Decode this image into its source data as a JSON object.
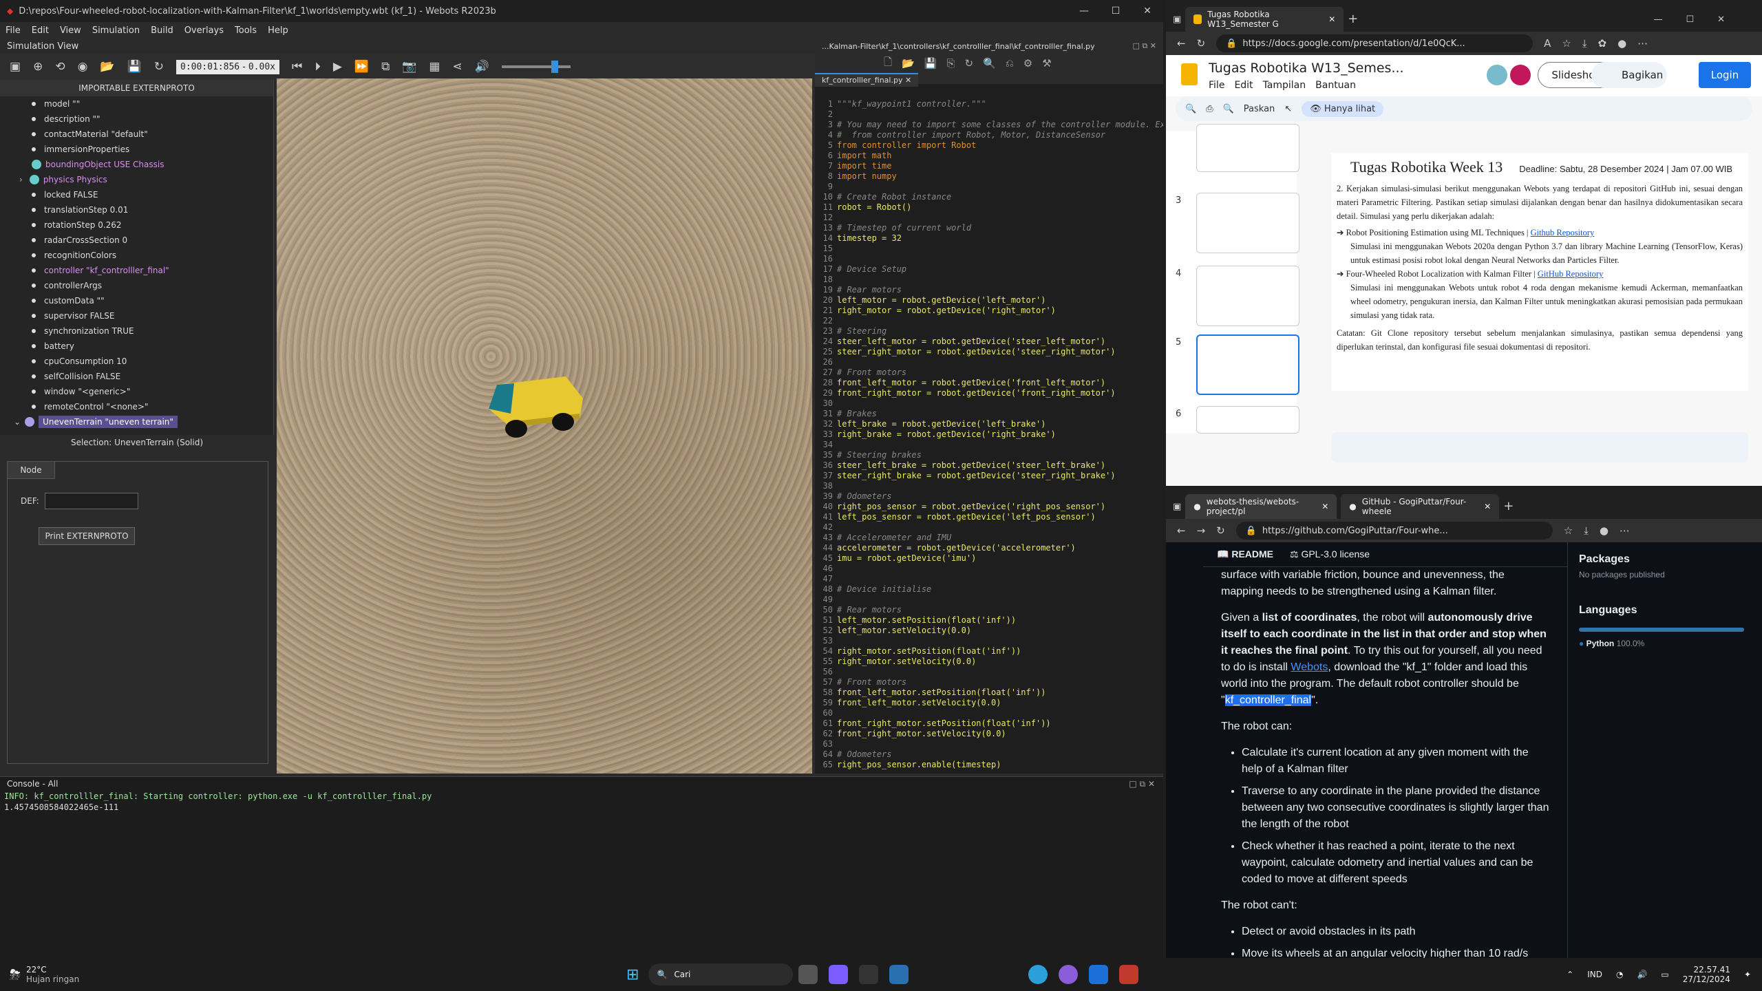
{
  "webots": {
    "title": "D:\\repos\\Four-wheeled-robot-localization-with-Kalman-Filter\\kf_1\\worlds\\empty.wbt (kf_1) - Webots R2023b",
    "menu": [
      "File",
      "Edit",
      "View",
      "Simulation",
      "Build",
      "Overlays",
      "Tools",
      "Help"
    ],
    "subtitle": "Simulation View",
    "time": "0:00:01:856",
    "speed": "0.00x",
    "tree_header": "IMPORTABLE EXTERNPROTO",
    "tree": [
      {
        "label": "model \"\"",
        "type": "dot"
      },
      {
        "label": "description \"\"",
        "type": "dot"
      },
      {
        "label": "contactMaterial \"default\"",
        "type": "dot"
      },
      {
        "label": "immersionProperties",
        "type": "dot"
      },
      {
        "label": "boundingObject USE Chassis",
        "type": "ball",
        "link": true
      },
      {
        "label": "physics Physics",
        "type": "ball",
        "link": true
      },
      {
        "label": "locked FALSE",
        "type": "dot"
      },
      {
        "label": "translationStep 0.01",
        "type": "dot"
      },
      {
        "label": "rotationStep 0.262",
        "type": "dot"
      },
      {
        "label": "radarCrossSection 0",
        "type": "dot"
      },
      {
        "label": "recognitionColors",
        "type": "dot"
      },
      {
        "label": "controller \"kf_controlller_final\"",
        "type": "dot",
        "link": true
      },
      {
        "label": "controllerArgs",
        "type": "dot"
      },
      {
        "label": "customData \"\"",
        "type": "dot"
      },
      {
        "label": "supervisor FALSE",
        "type": "dot"
      },
      {
        "label": "synchronization TRUE",
        "type": "dot"
      },
      {
        "label": "battery",
        "type": "dot"
      },
      {
        "label": "cpuConsumption 10",
        "type": "dot"
      },
      {
        "label": "selfCollision FALSE",
        "type": "dot"
      },
      {
        "label": "window \"<generic>\"",
        "type": "dot"
      },
      {
        "label": "remoteControl \"<none>\"",
        "type": "dot"
      }
    ],
    "selected_node": "UnevenTerrain \"uneven terrain\"",
    "selection": "Selection: UnevenTerrain (Solid)",
    "node_tab": "Node",
    "def_label": "DEF:",
    "print_button": "Print EXTERNPROTO",
    "editor_path": "...Kalman-Filter\\kf_1\\controllers\\kf_controlller_final\\kf_controlller_final.py",
    "editor_tab": "kf_controlller_final.py",
    "console_title": "Console - All",
    "console_lines": [
      "INFO: kf_controlller_final: Starting controller: python.exe -u kf_controlller_final.py",
      "1.4574508584022465e-111"
    ]
  },
  "code": [
    "\"\"\"kf_waypoint1 controller.\"\"\"",
    "",
    "# You may need to import some classes of the controller module. Ex",
    "#  from controller import Robot, Motor, DistanceSensor",
    "from controller import Robot",
    "import math",
    "import time",
    "import numpy",
    "",
    "# Create Robot instance",
    "robot = Robot()",
    "",
    "# Timestep of current world",
    "timestep = 32",
    "",
    "",
    "# Device Setup",
    "",
    "# Rear motors",
    "left_motor = robot.getDevice('left_motor')",
    "right_motor = robot.getDevice('right_motor')",
    "",
    "# Steering",
    "steer_left_motor = robot.getDevice('steer_left_motor')",
    "steer_right_motor = robot.getDevice('steer_right_motor')",
    "",
    "# Front motors",
    "front_left_motor = robot.getDevice('front_left_motor')",
    "front_right_motor = robot.getDevice('front_right_motor')",
    "",
    "# Brakes",
    "left_brake = robot.getDevice('left_brake')",
    "right_brake = robot.getDevice('right_brake')",
    "",
    "# Steering brakes",
    "steer_left_brake = robot.getDevice('steer_left_brake')",
    "steer_right_brake = robot.getDevice('steer_right_brake')",
    "",
    "# Odometers",
    "right_pos_sensor = robot.getDevice('right_pos_sensor')",
    "left_pos_sensor = robot.getDevice('left_pos_sensor')",
    "",
    "# Accelerometer and IMU",
    "accelerometer = robot.getDevice('accelerometer')",
    "imu = robot.getDevice('imu')",
    "",
    "",
    "# Device initialise",
    "",
    "# Rear motors",
    "left_motor.setPosition(float('inf'))",
    "left_motor.setVelocity(0.0)",
    "",
    "right_motor.setPosition(float('inf'))",
    "right_motor.setVelocity(0.0)",
    "",
    "# Front motors",
    "front_left_motor.setPosition(float('inf'))",
    "front_left_motor.setVelocity(0.0)",
    "",
    "front_right_motor.setPosition(float('inf'))",
    "front_right_motor.setVelocity(0.0)",
    "",
    "# Odometers",
    "right_pos_sensor.enable(timestep)"
  ],
  "slides": {
    "tab": "Tugas Robotika W13_Semester G",
    "url": "https://docs.google.com/presentation/d/1e0QcK...",
    "doc_title": "Tugas Robotika W13_Semes...",
    "menu": [
      "File",
      "Edit",
      "Tampilan",
      "Bantuan"
    ],
    "slideshow": "Slideshow",
    "share": "Bagikan",
    "login": "Login",
    "zoom": "Paskan",
    "viewonly": "Hanya lihat",
    "thumb_numbers": [
      "3",
      "4",
      "5",
      "6"
    ],
    "slide_title": "Tugas Robotika Week 13",
    "deadline": "Deadline: Sabtu, 28 Desember 2024  | Jam 07.00 WIB",
    "p1": "2. Kerjakan simulasi-simulasi berikut menggunakan Webots yang terdapat di repositori GitHub ini, sesuai dengan materi Parametric Filtering. Pastikan setiap simulasi dijalankan dengan benar dan hasilnya didokumentasikan secara detail. Simulasi yang perlu dikerjakan adalah:",
    "item1": "Robot Positioning Estimation using ML Techniques | ",
    "item1_link": "Github Repository",
    "item1_desc": "Simulasi ini menggunakan Webots 2020a dengan Python 3.7 dan library Machine Learning (TensorFlow, Keras) untuk estimasi posisi robot lokal dengan Neural Networks dan Particles Filter.",
    "item2": "Four-Wheeled Robot Localization with Kalman Filter | ",
    "item2_link": "GitHub Repository",
    "item2_desc": "Simulasi ini menggunakan Webots untuk robot 4 roda dengan mekanisme kemudi Ackerman, memanfaatkan wheel odometry, pengukuran inersia, dan Kalman Filter untuk meningkatkan akurasi pemosisian pada permukaan simulasi yang tidak rata.",
    "note": "Catatan: Git Clone repository tersebut sebelum menjalankan simulasinya, pastikan semua dependensi yang diperlukan terinstal, dan konfigurasi file sesuai dokumentasi di repositori."
  },
  "github": {
    "tab1": "webots-thesis/webots-project/pl",
    "tab2": "GitHub - GogiPuttar/Four-wheele",
    "url": "https://github.com/GogiPuttar/Four-whe...",
    "readme_tab": "README",
    "license_tab": "GPL-3.0 license",
    "intro_tail": "surface with variable friction, bounce and unevenness, the mapping needs to be strengthened using a Kalman filter.",
    "p_given_a": "Given a ",
    "p_given_b": "list of coordinates",
    "p_given_c": ", the robot will ",
    "p_given_d": "autonomously drive itself to each coordinate in the list in that order and stop when it reaches the final point",
    "p_given_e": ". To try this out for yourself, all you need to do is install ",
    "p_webots": "Webots",
    "p_given_f": ", download the \"kf_1\" folder and load this world into the program. The default robot controller should be \"",
    "p_ctrl": "kf_controller_final",
    "p_given_g": "\".",
    "can": "The robot can:",
    "can_items": [
      "Calculate it's current location at any given moment with the help of a Kalman filter",
      "Traverse to any coordinate in the plane provided the distance between any two consecutive coordinates is slightly larger than the length of the robot",
      "Check whether it has reached a point, iterate to the next waypoint, calculate odometry and inertial values and can be coded to move at different speeds"
    ],
    "cant": "The robot can't:",
    "cant_items": [
      "Detect or avoid obstacles in its path",
      "Move its wheels at an angular velocity higher than 10 rad/s"
    ],
    "packages": "Packages",
    "no_packages": "No packages published",
    "languages": "Languages",
    "lang": "Python",
    "lang_pct": "100.0%"
  },
  "taskbar": {
    "temp": "22°C",
    "weather": "Hujan ringan",
    "search": "Cari",
    "lang": "IND",
    "time": "22.57.41",
    "date": "27/12/2024"
  }
}
